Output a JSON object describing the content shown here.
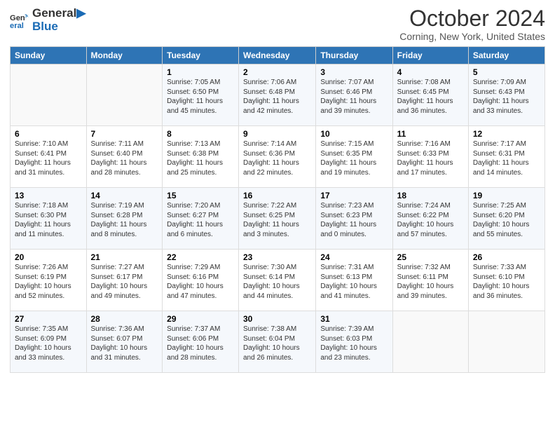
{
  "header": {
    "logo_line1": "General",
    "logo_line2": "Blue",
    "title": "October 2024",
    "location": "Corning, New York, United States"
  },
  "days_of_week": [
    "Sunday",
    "Monday",
    "Tuesday",
    "Wednesday",
    "Thursday",
    "Friday",
    "Saturday"
  ],
  "weeks": [
    [
      {
        "day": "",
        "sunrise": "",
        "sunset": "",
        "daylight": ""
      },
      {
        "day": "",
        "sunrise": "",
        "sunset": "",
        "daylight": ""
      },
      {
        "day": "1",
        "sunrise": "Sunrise: 7:05 AM",
        "sunset": "Sunset: 6:50 PM",
        "daylight": "Daylight: 11 hours and 45 minutes."
      },
      {
        "day": "2",
        "sunrise": "Sunrise: 7:06 AM",
        "sunset": "Sunset: 6:48 PM",
        "daylight": "Daylight: 11 hours and 42 minutes."
      },
      {
        "day": "3",
        "sunrise": "Sunrise: 7:07 AM",
        "sunset": "Sunset: 6:46 PM",
        "daylight": "Daylight: 11 hours and 39 minutes."
      },
      {
        "day": "4",
        "sunrise": "Sunrise: 7:08 AM",
        "sunset": "Sunset: 6:45 PM",
        "daylight": "Daylight: 11 hours and 36 minutes."
      },
      {
        "day": "5",
        "sunrise": "Sunrise: 7:09 AM",
        "sunset": "Sunset: 6:43 PM",
        "daylight": "Daylight: 11 hours and 33 minutes."
      }
    ],
    [
      {
        "day": "6",
        "sunrise": "Sunrise: 7:10 AM",
        "sunset": "Sunset: 6:41 PM",
        "daylight": "Daylight: 11 hours and 31 minutes."
      },
      {
        "day": "7",
        "sunrise": "Sunrise: 7:11 AM",
        "sunset": "Sunset: 6:40 PM",
        "daylight": "Daylight: 11 hours and 28 minutes."
      },
      {
        "day": "8",
        "sunrise": "Sunrise: 7:13 AM",
        "sunset": "Sunset: 6:38 PM",
        "daylight": "Daylight: 11 hours and 25 minutes."
      },
      {
        "day": "9",
        "sunrise": "Sunrise: 7:14 AM",
        "sunset": "Sunset: 6:36 PM",
        "daylight": "Daylight: 11 hours and 22 minutes."
      },
      {
        "day": "10",
        "sunrise": "Sunrise: 7:15 AM",
        "sunset": "Sunset: 6:35 PM",
        "daylight": "Daylight: 11 hours and 19 minutes."
      },
      {
        "day": "11",
        "sunrise": "Sunrise: 7:16 AM",
        "sunset": "Sunset: 6:33 PM",
        "daylight": "Daylight: 11 hours and 17 minutes."
      },
      {
        "day": "12",
        "sunrise": "Sunrise: 7:17 AM",
        "sunset": "Sunset: 6:31 PM",
        "daylight": "Daylight: 11 hours and 14 minutes."
      }
    ],
    [
      {
        "day": "13",
        "sunrise": "Sunrise: 7:18 AM",
        "sunset": "Sunset: 6:30 PM",
        "daylight": "Daylight: 11 hours and 11 minutes."
      },
      {
        "day": "14",
        "sunrise": "Sunrise: 7:19 AM",
        "sunset": "Sunset: 6:28 PM",
        "daylight": "Daylight: 11 hours and 8 minutes."
      },
      {
        "day": "15",
        "sunrise": "Sunrise: 7:20 AM",
        "sunset": "Sunset: 6:27 PM",
        "daylight": "Daylight: 11 hours and 6 minutes."
      },
      {
        "day": "16",
        "sunrise": "Sunrise: 7:22 AM",
        "sunset": "Sunset: 6:25 PM",
        "daylight": "Daylight: 11 hours and 3 minutes."
      },
      {
        "day": "17",
        "sunrise": "Sunrise: 7:23 AM",
        "sunset": "Sunset: 6:23 PM",
        "daylight": "Daylight: 11 hours and 0 minutes."
      },
      {
        "day": "18",
        "sunrise": "Sunrise: 7:24 AM",
        "sunset": "Sunset: 6:22 PM",
        "daylight": "Daylight: 10 hours and 57 minutes."
      },
      {
        "day": "19",
        "sunrise": "Sunrise: 7:25 AM",
        "sunset": "Sunset: 6:20 PM",
        "daylight": "Daylight: 10 hours and 55 minutes."
      }
    ],
    [
      {
        "day": "20",
        "sunrise": "Sunrise: 7:26 AM",
        "sunset": "Sunset: 6:19 PM",
        "daylight": "Daylight: 10 hours and 52 minutes."
      },
      {
        "day": "21",
        "sunrise": "Sunrise: 7:27 AM",
        "sunset": "Sunset: 6:17 PM",
        "daylight": "Daylight: 10 hours and 49 minutes."
      },
      {
        "day": "22",
        "sunrise": "Sunrise: 7:29 AM",
        "sunset": "Sunset: 6:16 PM",
        "daylight": "Daylight: 10 hours and 47 minutes."
      },
      {
        "day": "23",
        "sunrise": "Sunrise: 7:30 AM",
        "sunset": "Sunset: 6:14 PM",
        "daylight": "Daylight: 10 hours and 44 minutes."
      },
      {
        "day": "24",
        "sunrise": "Sunrise: 7:31 AM",
        "sunset": "Sunset: 6:13 PM",
        "daylight": "Daylight: 10 hours and 41 minutes."
      },
      {
        "day": "25",
        "sunrise": "Sunrise: 7:32 AM",
        "sunset": "Sunset: 6:11 PM",
        "daylight": "Daylight: 10 hours and 39 minutes."
      },
      {
        "day": "26",
        "sunrise": "Sunrise: 7:33 AM",
        "sunset": "Sunset: 6:10 PM",
        "daylight": "Daylight: 10 hours and 36 minutes."
      }
    ],
    [
      {
        "day": "27",
        "sunrise": "Sunrise: 7:35 AM",
        "sunset": "Sunset: 6:09 PM",
        "daylight": "Daylight: 10 hours and 33 minutes."
      },
      {
        "day": "28",
        "sunrise": "Sunrise: 7:36 AM",
        "sunset": "Sunset: 6:07 PM",
        "daylight": "Daylight: 10 hours and 31 minutes."
      },
      {
        "day": "29",
        "sunrise": "Sunrise: 7:37 AM",
        "sunset": "Sunset: 6:06 PM",
        "daylight": "Daylight: 10 hours and 28 minutes."
      },
      {
        "day": "30",
        "sunrise": "Sunrise: 7:38 AM",
        "sunset": "Sunset: 6:04 PM",
        "daylight": "Daylight: 10 hours and 26 minutes."
      },
      {
        "day": "31",
        "sunrise": "Sunrise: 7:39 AM",
        "sunset": "Sunset: 6:03 PM",
        "daylight": "Daylight: 10 hours and 23 minutes."
      },
      {
        "day": "",
        "sunrise": "",
        "sunset": "",
        "daylight": ""
      },
      {
        "day": "",
        "sunrise": "",
        "sunset": "",
        "daylight": ""
      }
    ]
  ]
}
